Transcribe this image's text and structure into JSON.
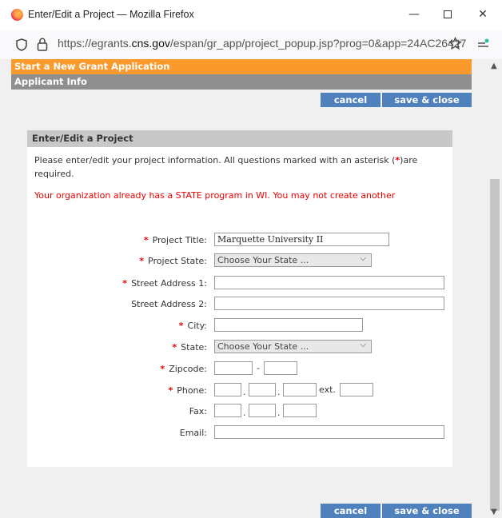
{
  "window": {
    "title": "Enter/Edit a Project — Mozilla Firefox",
    "min": "—",
    "close": "✕"
  },
  "url": {
    "prefix": "https://egrants.",
    "domain": "cns.gov",
    "suffix": "/espan/gr_app/project_popup.jsp?prog=0&app=24AC26427"
  },
  "header": {
    "new_app": "Start a New Grant Application",
    "applicant": "Applicant Info"
  },
  "buttons": {
    "cancel": "cancel",
    "save_close": "save & close"
  },
  "panel": {
    "title": "Enter/Edit a Project",
    "instructions_a": "Please enter/edit your project information.  All questions marked with an asterisk (",
    "instructions_star": "*",
    "instructions_b": ")are required.",
    "error": "Your organization already has a STATE program in WI. You may not create another"
  },
  "form": {
    "star": "*",
    "project_title_label": "Project Title:",
    "project_title_value": "Marquette University II",
    "project_state_label": "Project State:",
    "project_state_value": "Choose Your State ...",
    "street1_label": "Street Address 1:",
    "street2_label": "Street Address 2:",
    "city_label": "City:",
    "state_label": "State:",
    "state_value": "Choose Your State ...",
    "zip_label": "Zipcode:",
    "zip_sep": "-",
    "phone_label": "Phone:",
    "phone_sep": ".",
    "ext_label": "ext.",
    "fax_label": "Fax:",
    "email_label": "Email:"
  }
}
